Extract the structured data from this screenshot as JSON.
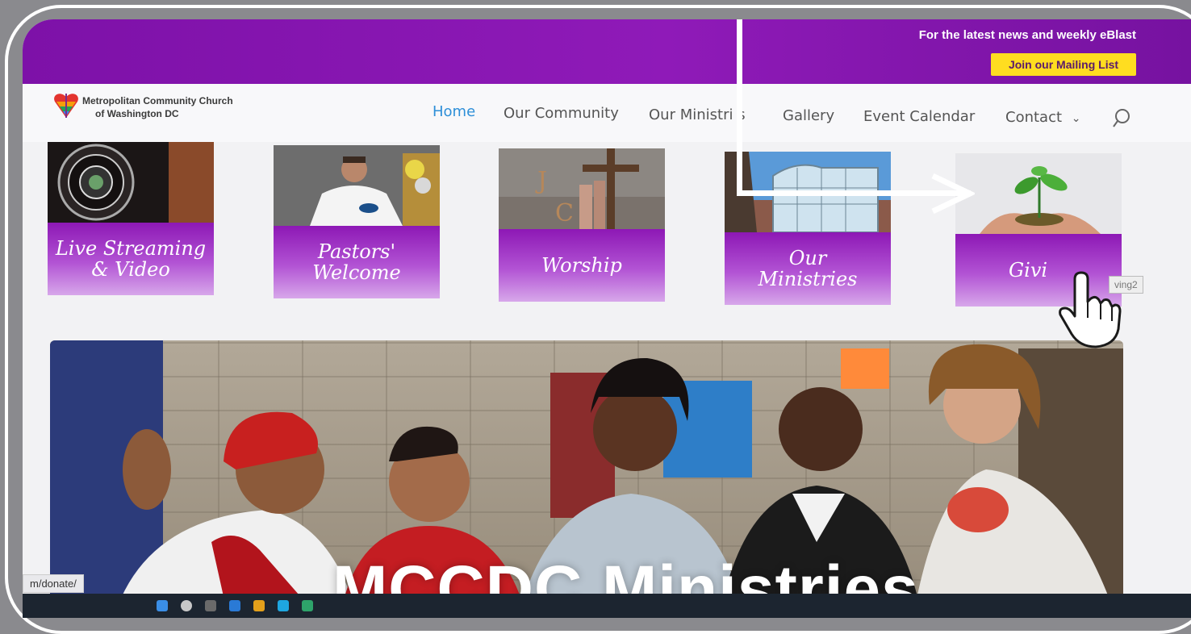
{
  "banner": {
    "text": "For the latest news and weekly eBlast",
    "button_label": "Join our Mailing List"
  },
  "site": {
    "name_line1": "Metropolitan Community Church",
    "name_line2": "of Washington DC"
  },
  "nav": {
    "items": [
      {
        "label": "Home",
        "active": true
      },
      {
        "label": "Our Community"
      },
      {
        "label": "Our Ministri s"
      },
      {
        "label": "Gallery"
      },
      {
        "label": "Event Calendar"
      },
      {
        "label": "Contact"
      }
    ],
    "contact_chevron": "⌄"
  },
  "tiles": [
    {
      "label": "Live Streaming\n& Video",
      "icon": "camera-lens"
    },
    {
      "label": "Pastors'\nWelcome",
      "icon": "pastor-photo"
    },
    {
      "label": "Worship",
      "icon": "cross-photo"
    },
    {
      "label": "Our\nMinistries",
      "icon": "building-photo"
    },
    {
      "label": "Givi",
      "icon": "seedling-photo"
    }
  ],
  "tooltip": "ving2",
  "hero": {
    "title": "MCCDC Ministries"
  },
  "status_bar": {
    "url": "m/donate/"
  },
  "colors": {
    "banner_purple": "#8414ae",
    "mail_button_yellow": "#ffdd20",
    "nav_active_blue": "#2e8fd8",
    "tile_gradient_top": "#8d18b5"
  }
}
